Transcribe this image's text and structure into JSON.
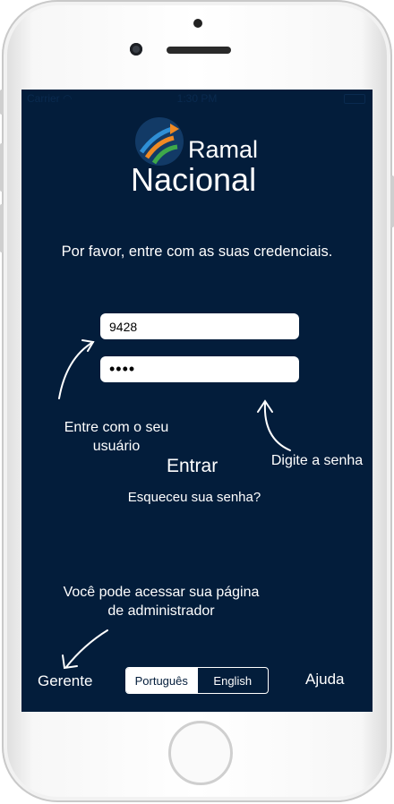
{
  "status_bar": {
    "carrier": "Carrier",
    "time": "1:30 PM"
  },
  "brand": {
    "line1": "Ramal",
    "line2": "Nacional"
  },
  "prompt": "Por favor, entre com as suas credenciais.",
  "login": {
    "username_value": "9428",
    "password_value": "••••",
    "submit_label": "Entrar",
    "forgot_label": "Esqueceu sua senha?"
  },
  "hints": {
    "username": "Entre com o seu usuário",
    "password": "Digite a senha",
    "admin": "Você pode acessar sua página de administrador"
  },
  "bottom": {
    "manager_label": "Gerente",
    "help_label": "Ajuda",
    "languages": [
      "Português",
      "English"
    ],
    "selected_language": "Português"
  },
  "colors": {
    "background": "#031d3b",
    "text": "#ffffff"
  }
}
